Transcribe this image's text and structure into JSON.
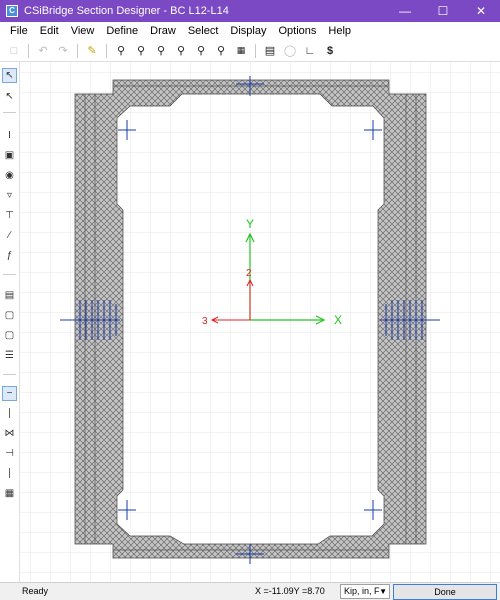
{
  "window": {
    "title": "CSiBridge Section Designer - BC L12-L14",
    "icon": "csi-app-icon",
    "controls": [
      "minimize",
      "maximize",
      "close"
    ]
  },
  "menu": [
    "File",
    "Edit",
    "View",
    "Define",
    "Draw",
    "Select",
    "Display",
    "Options",
    "Help"
  ],
  "toolbar": {
    "icons": [
      "new-icon",
      "undo-icon",
      "redo-icon",
      "pencil-icon",
      "zoom-window-icon",
      "zoom-restore-icon",
      "zoom-in-icon",
      "zoom-out-icon",
      "pan-icon",
      "zoom-previous-icon",
      "section-props-icon",
      "properties-icon",
      "display-icon",
      "moment-curvature-icon",
      "interaction-icon"
    ]
  },
  "left_toolbar": {
    "icons": [
      "pointer-icon",
      "reshape-icon",
      "draw-structural-icon",
      "draw-rect-icon",
      "draw-circle-icon",
      "draw-poly-icon",
      "draw-caltrans-icon",
      "draw-line-icon",
      "draw-rebar-icon",
      "draw-plate-icon",
      "draw-solid-icon",
      "draw-hollow-icon",
      "draw-ref-icon",
      "draw-single-bar-icon",
      "draw-bar-line-icon",
      "draw-bar-rect-icon",
      "draw-bar-circle-icon",
      "draw-bar-edge-icon",
      "draw-bar-poly-icon"
    ]
  },
  "canvas": {
    "axis_x_label": "X",
    "axis_y_label": "Y",
    "axis_3_label": "3",
    "axis_2_label": "2",
    "grid_color": "#d9d9d9",
    "shape_fill": "#b8b8b8",
    "rebar_color": "#1a3aa8",
    "x_axis_color": "#22c422",
    "y_axis_color": "#22c422",
    "local_axis_color": "#e02020"
  },
  "status": {
    "ready": "Ready",
    "coords": "X =-11.09Y =8.70",
    "units": "Kip, in, F",
    "done": "Done"
  }
}
